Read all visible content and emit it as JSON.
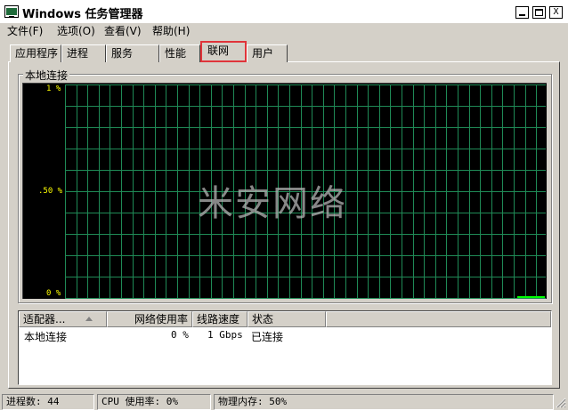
{
  "window": {
    "title": "Windows 任务管理器",
    "icon": "task-manager-icon",
    "min_glyph": "minimize-icon",
    "max_glyph": "maximize-icon",
    "close_label": "X"
  },
  "menu": [
    {
      "label": "文件(F)"
    },
    {
      "label": "选项(O)"
    },
    {
      "label": "查看(V)"
    },
    {
      "label": "帮助(H)"
    }
  ],
  "tabs": [
    {
      "label": "应用程序",
      "active": false
    },
    {
      "label": "进程",
      "active": false
    },
    {
      "label": "服务",
      "active": false
    },
    {
      "label": "性能",
      "active": false
    },
    {
      "label": "联网",
      "active": true
    },
    {
      "label": "用户",
      "active": false
    }
  ],
  "group": {
    "label": "本地连接"
  },
  "graph": {
    "y_labels": {
      "top": "1 %",
      "mid": ".50 %",
      "bottom": "0 %"
    },
    "grid_color": "#1f8a56",
    "trace_color": "#00ff00",
    "current_utilization_percent": 0
  },
  "watermark": "米安网络",
  "list": {
    "columns": [
      "适配器...",
      "网络使用率",
      "线路速度",
      "状态"
    ],
    "rows": [
      {
        "adapter": "本地连接",
        "usage": "0 %",
        "speed": "1 Gbps",
        "status": "已连接"
      }
    ]
  },
  "status": {
    "processes": "进程数: 44",
    "cpu": "CPU 使用率: 0%",
    "memory": "物理内存: 50%"
  },
  "colors": {
    "face": "#d4d0c8",
    "highlight_tab_border": "#e0343a",
    "label_yellow": "#ffff00"
  }
}
